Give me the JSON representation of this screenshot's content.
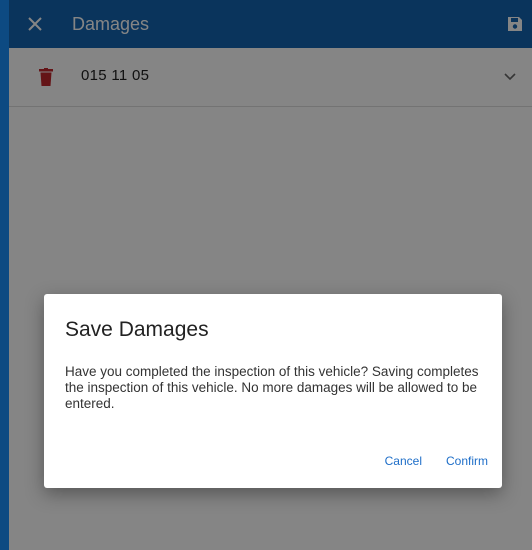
{
  "header": {
    "title": "Damages",
    "close_icon": "close-icon",
    "save_icon": "save-icon"
  },
  "list": {
    "items": [
      {
        "text": "015 11 05",
        "icon": "trash-icon",
        "expand_icon": "chevron-down-icon"
      }
    ]
  },
  "dialog": {
    "title": "Save Damages",
    "body": "Have you completed the inspection of this vehicle? Saving completes the inspection of this vehicle. No more damages will be allowed to be entered.",
    "cancel_label": "Cancel",
    "confirm_label": "Confirm"
  },
  "colors": {
    "header_bg": "#1565b0",
    "trash": "#c0282d",
    "accent": "#1e6ec8"
  }
}
